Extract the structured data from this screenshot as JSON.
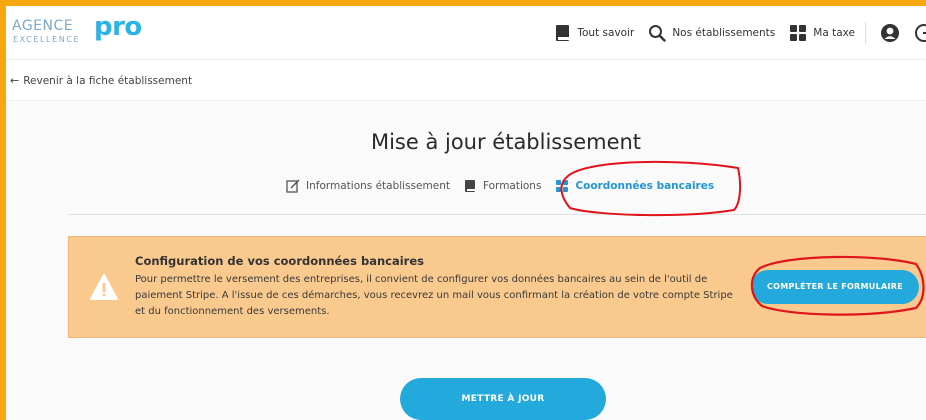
{
  "header": {
    "logo": {
      "agence": "AGENCE",
      "excellence": "EXCELLENCE",
      "pro": "pro"
    },
    "nav": {
      "tout_savoir": "Tout savoir",
      "nos_etablissements": "Nos établissements",
      "ma_taxe": "Ma taxe"
    }
  },
  "backbar": {
    "arrow": "←",
    "label": "Revenir à la fiche établissement"
  },
  "main": {
    "title": "Mise à jour établissement",
    "tabs": [
      {
        "label": "Informations établissement",
        "icon": "edit-icon"
      },
      {
        "label": "Formations",
        "icon": "book-icon"
      },
      {
        "label": "Coordonnées bancaires",
        "icon": "grid-icon",
        "active": true
      }
    ],
    "alert": {
      "title": "Configuration de vos coordonnées bancaires",
      "text": "Pour permettre le versement des entreprises, il convient de configurer vos données bancaires au sein de l'outil de paiement Stripe. A l'issue de ces démarches, vous recevrez un mail vous confirmant la création de votre compte Stripe et du fonctionnement des versements.",
      "button": "COMPLÉTER LE FORMULAIRE"
    },
    "update_button": "METTRE À JOUR"
  },
  "colors": {
    "accent": "#24a9dc",
    "frame": "#f7a70f",
    "alert_bg": "#f9c98e",
    "annotation": "#e0141b"
  }
}
